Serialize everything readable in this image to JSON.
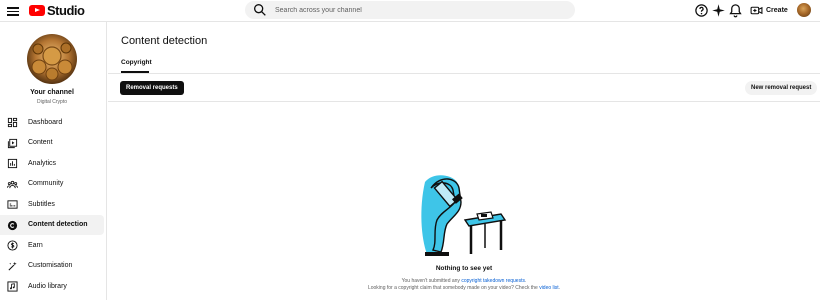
{
  "app": {
    "logo_text": "Studio",
    "brand_color": "#ff0000",
    "accent": "#065fd4"
  },
  "topbar": {
    "search_placeholder": "Search across your channel",
    "icons": [
      "menu-icon",
      "search-icon",
      "help-icon",
      "sparkle-icon",
      "bell-icon",
      "create-video-icon"
    ],
    "create_label": "Create"
  },
  "sidebar": {
    "channel_name": "Your channel",
    "channel_handle": "Digital Crypto",
    "items": [
      {
        "label": "Dashboard",
        "icon": "dashboard-icon",
        "active": false
      },
      {
        "label": "Content",
        "icon": "content-icon",
        "active": false
      },
      {
        "label": "Analytics",
        "icon": "analytics-icon",
        "active": false
      },
      {
        "label": "Community",
        "icon": "community-icon",
        "active": false
      },
      {
        "label": "Subtitles",
        "icon": "subtitles-icon",
        "active": false
      },
      {
        "label": "Content detection",
        "icon": "copyright-icon",
        "active": true
      },
      {
        "label": "Earn",
        "icon": "dollar-icon",
        "active": false
      },
      {
        "label": "Customisation",
        "icon": "magic-wand-icon",
        "active": false
      },
      {
        "label": "Audio library",
        "icon": "audio-library-icon",
        "active": false
      }
    ]
  },
  "main": {
    "title": "Content detection",
    "tabs": [
      {
        "label": "Copyright",
        "active": true
      }
    ],
    "removal_requests_label": "Removal requests",
    "new_removal_request_label": "New removal request",
    "empty_state": {
      "title": "Nothing to see yet",
      "line1_prefix": "You haven't submitted any ",
      "line1_link": "copyright takedown requests",
      "line1_suffix": ".",
      "line2_prefix": "Looking for a copyright claim that somebody made on your video? Check the ",
      "line2_link": "video list",
      "line2_suffix": "."
    }
  }
}
